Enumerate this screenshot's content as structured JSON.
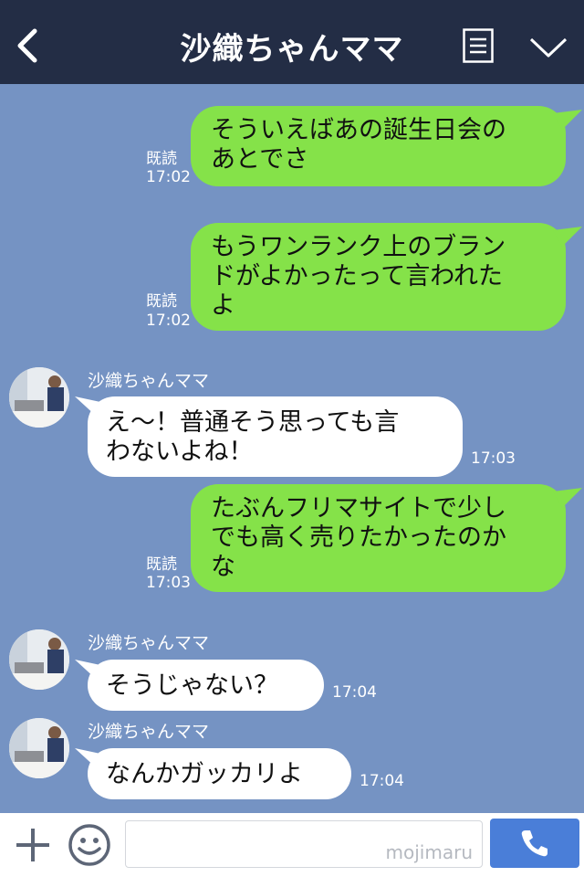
{
  "header": {
    "title": "沙織ちゃんママ"
  },
  "contact": {
    "name": "沙織ちゃんママ"
  },
  "messages": [
    {
      "side": "out",
      "text_lines": [
        "そういえばあの誕生日会の",
        "あとでさ"
      ],
      "read": "既読",
      "time": "17:02"
    },
    {
      "side": "out",
      "text_lines": [
        "もうワンランク上のブラン",
        "ドがよかったって言われた",
        "よ"
      ],
      "read": "既読",
      "time": "17:02"
    },
    {
      "side": "in",
      "sender": "沙織ちゃんママ",
      "text_lines": [
        "え〜！普通そう思っても言",
        "わないよね！"
      ],
      "time": "17:03"
    },
    {
      "side": "out",
      "text_lines": [
        "たぶんフリマサイトで少し",
        "でも高く売りたかったのか",
        "な"
      ],
      "read": "既読",
      "time": "17:03"
    },
    {
      "side": "in",
      "sender": "沙織ちゃんママ",
      "text_lines": [
        "そうじゃない？"
      ],
      "time": "17:04"
    },
    {
      "side": "in",
      "sender": "沙織ちゃんママ",
      "text_lines": [
        "なんかガッカリよ"
      ],
      "time": "17:04"
    }
  ],
  "footer": {
    "watermark": "mojimaru",
    "icons": [
      "plus-icon",
      "emoji-icon",
      "phone-icon"
    ]
  },
  "colors": {
    "header": "#232d45",
    "background": "#7593c3",
    "outgoing": "#85e249",
    "incoming": "#ffffff",
    "call_button": "#4a7ed8"
  }
}
